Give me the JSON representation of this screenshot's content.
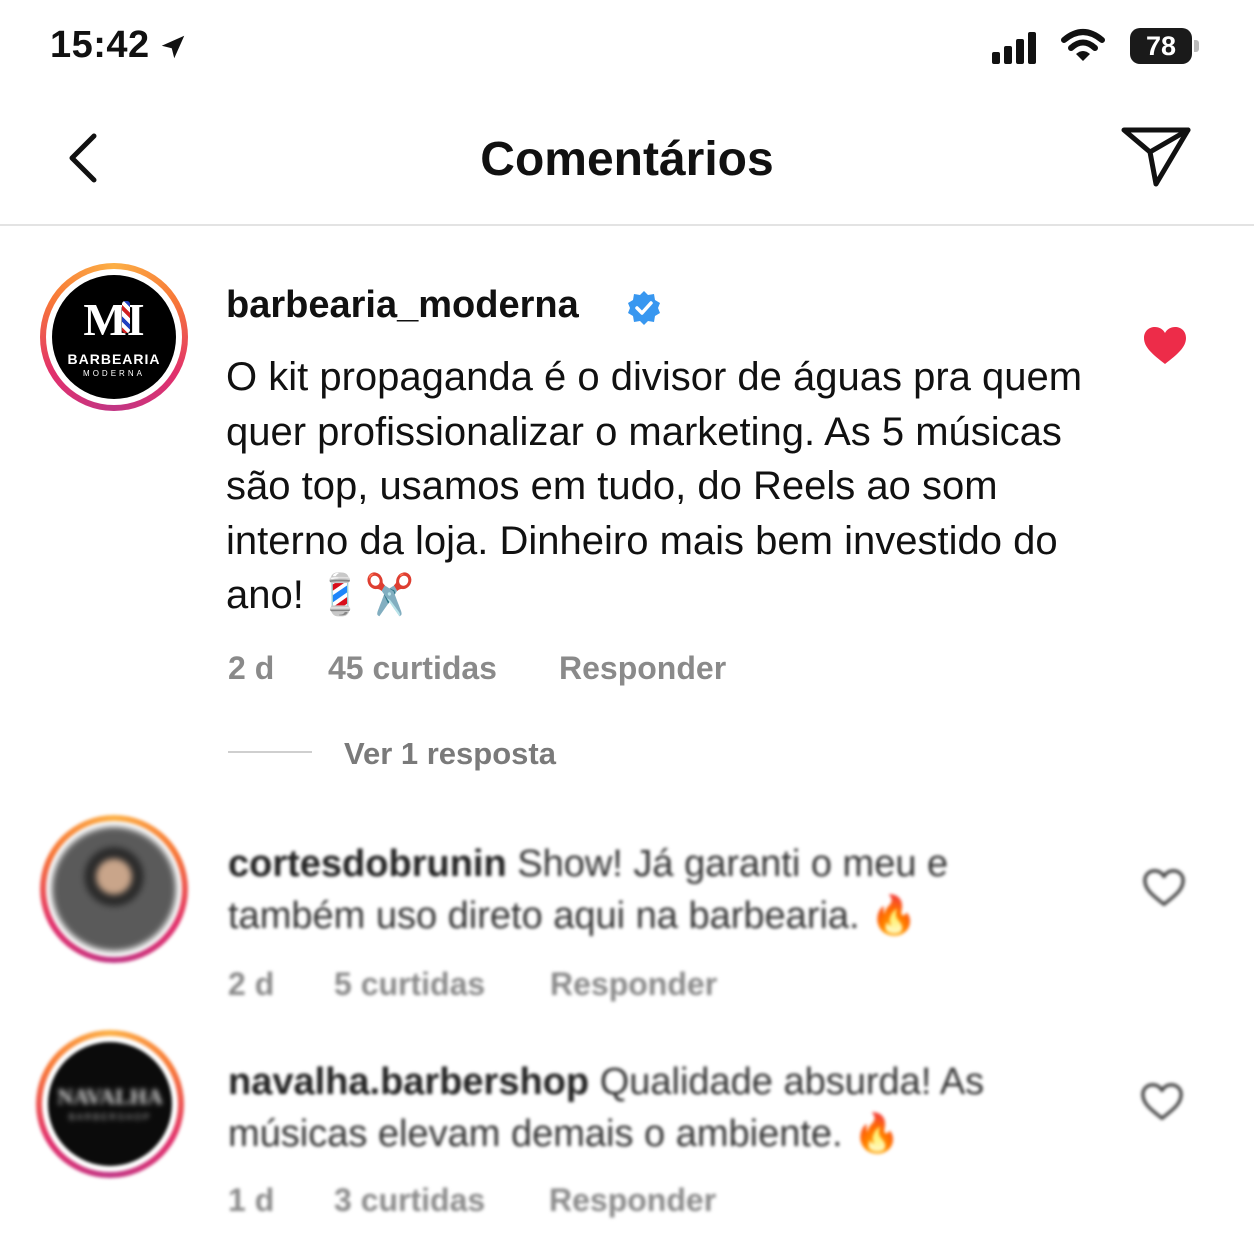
{
  "status_bar": {
    "time": "15:42",
    "battery": "78"
  },
  "header": {
    "title": "Comentários"
  },
  "main_comment": {
    "avatar_logo": {
      "text": "MI",
      "brand": "BARBEARIA",
      "sub": "MODERNA"
    },
    "username": "barbearia_moderna",
    "verified": true,
    "text": "O kit propaganda é o divisor de águas pra quem quer profissionalizar o marketing. As 5 músicas são top, usamos em tudo, do Reels ao som interno da loja. Dinheiro mais bem investido do ano! 💈✂️",
    "time": "2 d",
    "likes": "45 curtidas",
    "reply": "Responder",
    "liked": true,
    "view_replies": "Ver 1 resposta"
  },
  "comments": [
    {
      "username": "cortesdobrunin",
      "text": "Show! Já garanti o meu e também uso direto aqui na barbearia. 🔥",
      "time": "2 d",
      "likes": "5 curtidas",
      "reply": "Responder"
    },
    {
      "username": "navalha.barbershop",
      "avatar_logo": {
        "text": "NAVALHA",
        "sub": "BARBERSHOP"
      },
      "text": "Qualidade absurda! As músicas elevam demais o ambiente. 🔥",
      "time": "1 d",
      "likes": "3 curtidas",
      "reply": "Responder"
    }
  ],
  "colors": {
    "heart_liked": "#ed2c49",
    "verified": "#3897f0",
    "meta_text": "#8a8a8a"
  }
}
